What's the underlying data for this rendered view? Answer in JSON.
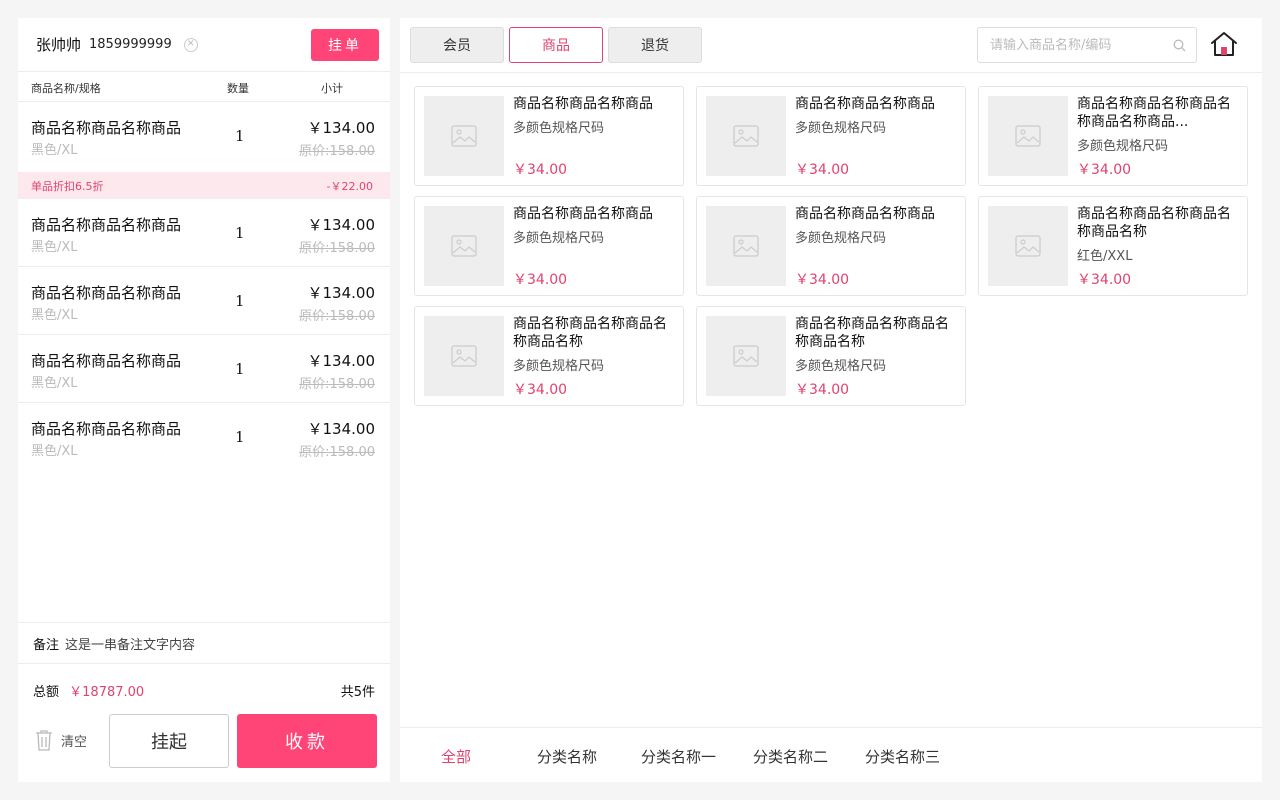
{
  "customer": {
    "name": "张帅帅",
    "phone": "1859999999"
  },
  "hang_button": "挂单",
  "order_columns": {
    "name": "商品名称/规格",
    "qty": "数量",
    "subtotal": "小计"
  },
  "order_items": [
    {
      "name": "商品名称商品名称商品",
      "spec": "黑色/XL",
      "qty": "1",
      "price": "￥134.00",
      "original": "原价:158.00"
    },
    {
      "name": "商品名称商品名称商品",
      "spec": "黑色/XL",
      "qty": "1",
      "price": "￥134.00",
      "original": "原价:158.00"
    },
    {
      "name": "商品名称商品名称商品",
      "spec": "黑色/XL",
      "qty": "1",
      "price": "￥134.00",
      "original": "原价:158.00"
    },
    {
      "name": "商品名称商品名称商品",
      "spec": "黑色/XL",
      "qty": "1",
      "price": "￥134.00",
      "original": "原价:158.00"
    },
    {
      "name": "商品名称商品名称商品",
      "spec": "黑色/XL",
      "qty": "1",
      "price": "￥134.00",
      "original": "原价:158.00"
    }
  ],
  "discount": {
    "label": "单品折扣6.5折",
    "amount": "-￥22.00"
  },
  "note": {
    "label": "备注",
    "value": "这是一串备注文字内容"
  },
  "summary": {
    "total_label": "总额",
    "total_value": "￥18787.00",
    "count": "共5件"
  },
  "actions": {
    "clear": "清空",
    "hold": "挂起",
    "pay": "收款"
  },
  "tabs": [
    {
      "label": "会员",
      "active": false
    },
    {
      "label": "商品",
      "active": true
    },
    {
      "label": "退货",
      "active": false
    }
  ],
  "search": {
    "placeholder": "请输入商品名称/编码",
    "value": ""
  },
  "products": [
    {
      "title": "商品名称商品名称商品",
      "spec": "多颜色规格尺码",
      "price": "￥34.00"
    },
    {
      "title": "商品名称商品名称商品",
      "spec": "多颜色规格尺码",
      "price": "￥34.00"
    },
    {
      "title": "商品名称商品名称商品名称商品名称商品...",
      "spec": "多颜色规格尺码",
      "price": "￥34.00"
    },
    {
      "title": "商品名称商品名称商品",
      "spec": "多颜色规格尺码",
      "price": "￥34.00"
    },
    {
      "title": "商品名称商品名称商品",
      "spec": "多颜色规格尺码",
      "price": "￥34.00"
    },
    {
      "title": "商品名称商品名称商品名称商品名称",
      "spec": "红色/XXL",
      "price": "￥34.00"
    },
    {
      "title": "商品名称商品名称商品名称商品名称",
      "spec": "多颜色规格尺码",
      "price": "￥34.00"
    },
    {
      "title": "商品名称商品名称商品名称商品名称",
      "spec": "多颜色规格尺码",
      "price": "￥34.00"
    }
  ],
  "categories": [
    {
      "label": "全部",
      "active": true
    },
    {
      "label": "分类名称",
      "active": false
    },
    {
      "label": "分类名称一",
      "active": false
    },
    {
      "label": "分类名称二",
      "active": false
    },
    {
      "label": "分类名称三",
      "active": false
    }
  ],
  "colors": {
    "accent": "#ff4477",
    "accent_text": "#e0436e",
    "discount_bg": "#fde8ee"
  },
  "icons": {
    "home": "home-icon",
    "search": "search-icon",
    "clear_customer": "close-circle-icon",
    "trash": "trash-icon",
    "image_placeholder": "image-icon"
  }
}
